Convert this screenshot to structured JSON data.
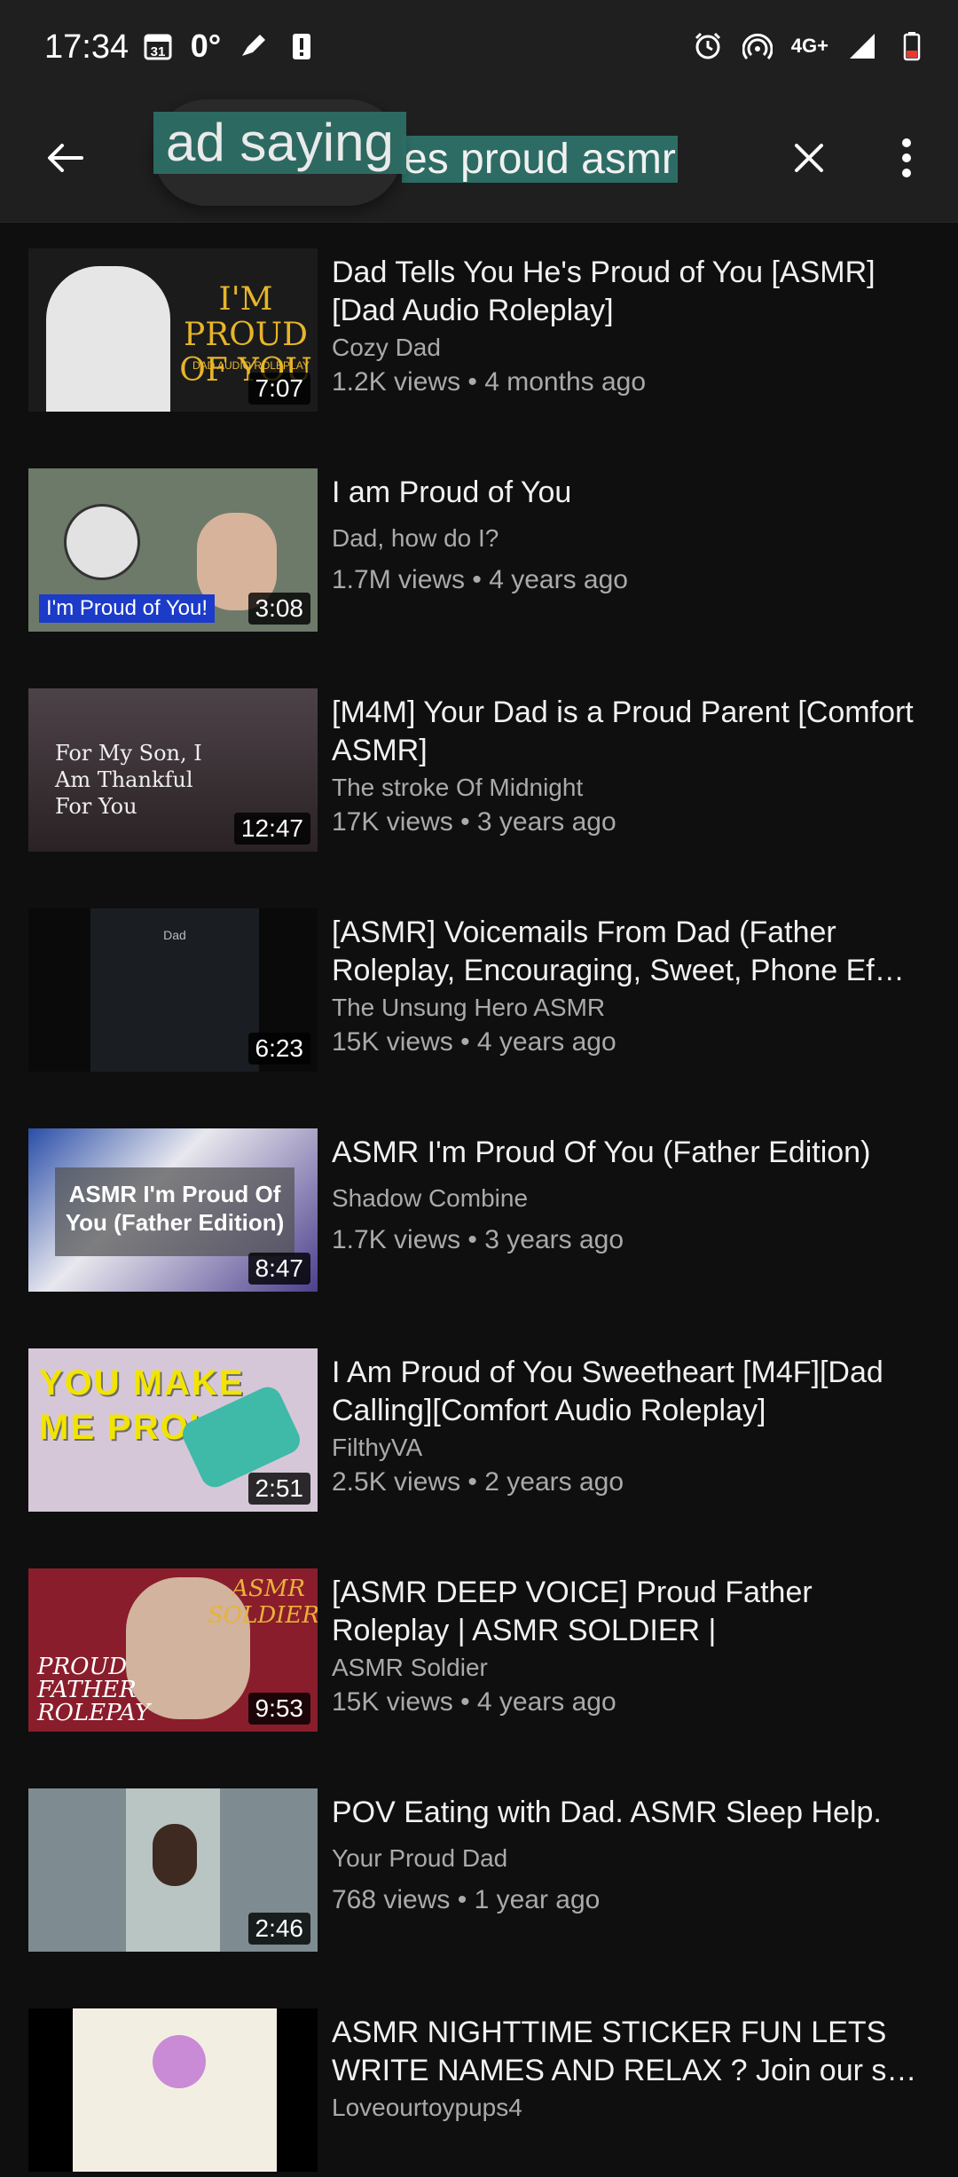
{
  "status_bar": {
    "time": "17:34",
    "calendar_day": "31",
    "temp": "0°",
    "network": "4G+"
  },
  "search": {
    "visible_query": "es proud asmr",
    "magnifier_text": "ad saying"
  },
  "videos": [
    {
      "title": "Dad Tells You He's Proud of You [ASMR] [Dad Audio Roleplay]",
      "channel": "Cozy Dad",
      "stats": "1.2K views • 4 months ago",
      "duration": "7:07",
      "thumb_text": "I'M PROUD OF YOU",
      "thumb_sub": "DAD AUDIO ROLEPLAY"
    },
    {
      "title": "I am Proud of You",
      "channel": "Dad, how do I?",
      "stats": "1.7M views • 4 years ago",
      "duration": "3:08",
      "thumb_text": "I'm Proud of You!"
    },
    {
      "title": "[M4M] Your Dad is a Proud Parent [Comfort ASMR]",
      "channel": "The stroke Of Midnight",
      "stats": "17K views • 3 years ago",
      "duration": "12:47",
      "thumb_text": "For My Son, I Am Thankful For You"
    },
    {
      "title": "[ASMR] Voicemails From Dad (Father Roleplay, Encouraging, Sweet, Phone Ef…",
      "channel": "The Unsung Hero ASMR",
      "stats": "15K views • 4 years ago",
      "duration": "6:23",
      "thumb_text": "Dad"
    },
    {
      "title": "ASMR I'm Proud Of You (Father Edition)",
      "channel": "Shadow Combine",
      "stats": "1.7K views • 3 years ago",
      "duration": "8:47",
      "thumb_text": "ASMR I'm Proud Of You (Father Edition)"
    },
    {
      "title": "I Am Proud of You Sweetheart [M4F][Dad Calling][Comfort Audio Roleplay]",
      "channel": "FilthyVA",
      "stats": "2.5K views • 2 years ago",
      "duration": "2:51",
      "thumb_text": "YOU MAKE ME PROUD!"
    },
    {
      "title": "[ASMR DEEP VOICE] Proud Father Roleplay | ASMR SOLDIER |",
      "channel": "ASMR Soldier",
      "stats": "15K views • 4 years ago",
      "duration": "9:53",
      "thumb_text": "ASMR SOLDIER",
      "thumb_sub": "PROUD FATHER ROLEPAY"
    },
    {
      "title": "POV Eating with Dad. ASMR Sleep Help.",
      "channel": "Your Proud Dad",
      "stats": "768 views • 1 year ago",
      "duration": "2:46"
    },
    {
      "title": "ASMR NIGHTTIME STICKER FUN LETS WRITE NAMES AND RELAX ? Join our s…",
      "channel": "Loveourtoypups4",
      "stats": "",
      "duration": ""
    }
  ]
}
